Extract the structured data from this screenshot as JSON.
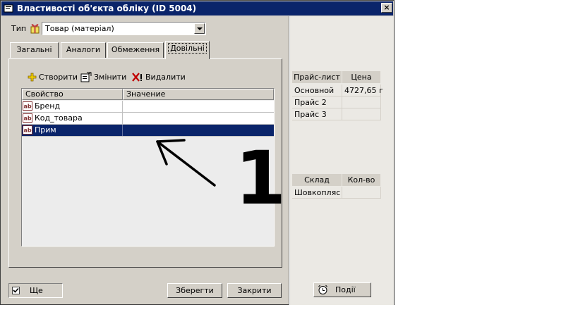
{
  "window": {
    "title": "Властивості об'єкта обліку  (ID 5004)",
    "close_glyph": "×"
  },
  "type_field": {
    "label": "Тип",
    "value": "Товар (матеріал)"
  },
  "tabs": [
    {
      "label": "Загальні"
    },
    {
      "label": "Аналоги"
    },
    {
      "label": "Обмеження"
    },
    {
      "label": "Довільні"
    }
  ],
  "toolbar": {
    "create": "Створити",
    "edit": "Змінити",
    "delete": "Видалити"
  },
  "grid": {
    "columns": [
      "Свойство",
      "Значение"
    ],
    "rows": [
      {
        "property": "Бренд",
        "value": ""
      },
      {
        "property": "Код_товара",
        "value": ""
      },
      {
        "property": "Прим",
        "value": ""
      }
    ],
    "selected_row": 2
  },
  "footer": {
    "more_label": "Ще",
    "save": "Зберегти",
    "close": "Закрити",
    "events": "Події"
  },
  "price_table": {
    "headers": [
      "Прайс-лист",
      "Цена"
    ],
    "rows": [
      {
        "name": "Основной",
        "price": "4727,65 г"
      },
      {
        "name": "Прайс 2",
        "price": ""
      },
      {
        "name": "Прайс 3",
        "price": ""
      }
    ]
  },
  "stock_table": {
    "headers": [
      "Склад",
      "Кол-во"
    ],
    "rows": [
      {
        "name": "Шовкопляс",
        "qty": ""
      }
    ]
  },
  "annotation": {
    "number": "1"
  },
  "colors": {
    "titlebar": "#0a246a",
    "face": "#d4d0c8",
    "selection": "#0a246a"
  }
}
